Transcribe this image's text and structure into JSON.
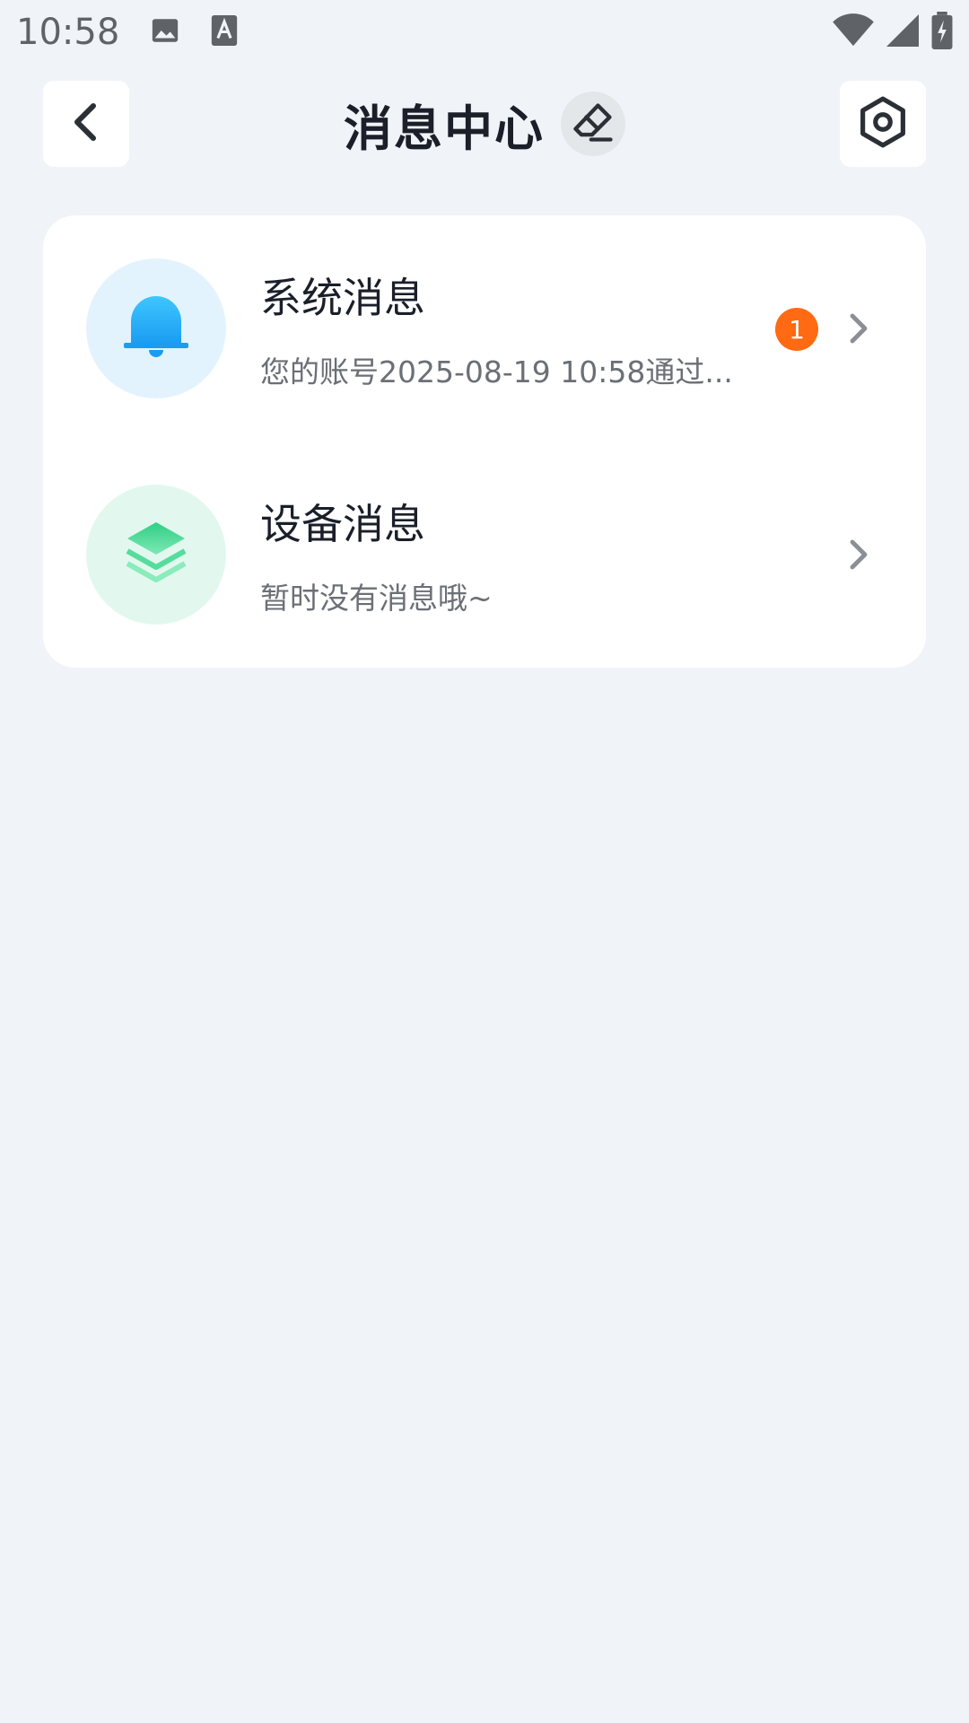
{
  "status_bar": {
    "time": "10:58",
    "icons": [
      "image-icon",
      "text-a-icon",
      "wifi-icon",
      "signal-icon",
      "battery-charging-icon"
    ]
  },
  "header": {
    "title": "消息中心",
    "back_icon": "chevron-left-icon",
    "clear_icon": "eraser-icon",
    "settings_icon": "hexagon-settings-icon"
  },
  "messages": [
    {
      "title": "系统消息",
      "preview": "您的账号2025-08-19 10:58通过...",
      "badge": "1",
      "icon": "bell-icon",
      "color": "#1fb4f5"
    },
    {
      "title": "设备消息",
      "preview": "暂时没有消息哦~",
      "icon": "layers-icon",
      "color": "#34d78a"
    }
  ],
  "colors": {
    "background": "#f0f4f8",
    "badge": "#ff6a13",
    "text_primary": "#1a1f29",
    "text_secondary": "#6b6f76"
  }
}
